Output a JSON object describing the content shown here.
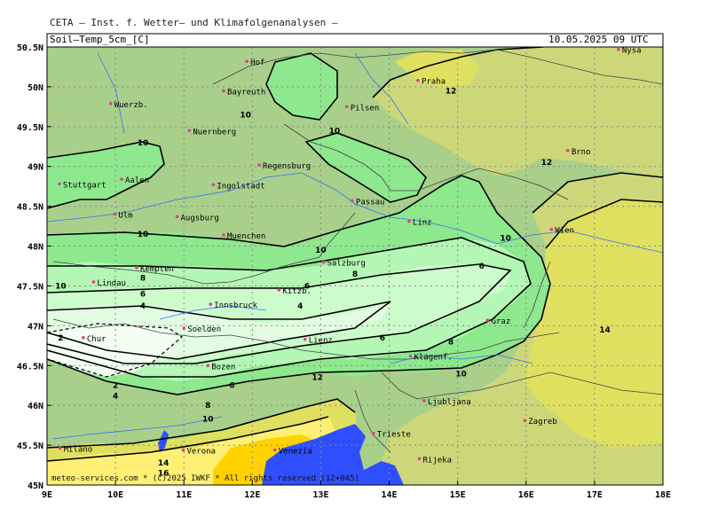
{
  "header": {
    "title": "CETA — Inst. f. Wetter— und Klimafolgenanalysen —",
    "field": "Soil—Temp_5cm",
    "unit": "C",
    "datetime": "10.05.2025 09 UTC"
  },
  "footer": "meteo-services.com * (c)2025 IWKF * All rights reserved (12+045)",
  "axes": {
    "y_labels": [
      "50.5N",
      "50N",
      "49.5N",
      "49N",
      "48.5N",
      "48N",
      "47.5N",
      "47N",
      "46.5N",
      "46N",
      "45.5N",
      "45N"
    ],
    "x_labels": [
      "9E",
      "10E",
      "11E",
      "12E",
      "13E",
      "14E",
      "15E",
      "16E",
      "17E",
      "18E"
    ]
  },
  "cities": [
    {
      "name": "Nysa",
      "lon": 17.35,
      "lat": 50.47
    },
    {
      "name": "Praha",
      "lon": 14.42,
      "lat": 50.08
    },
    {
      "name": "Hof",
      "lon": 11.92,
      "lat": 50.32
    },
    {
      "name": "Bayreuth",
      "lon": 11.58,
      "lat": 49.95
    },
    {
      "name": "Wuerzb.",
      "lon": 9.93,
      "lat": 49.79
    },
    {
      "name": "Pilsen",
      "lon": 13.38,
      "lat": 49.75
    },
    {
      "name": "Nuernberg",
      "lon": 11.08,
      "lat": 49.45
    },
    {
      "name": "Brno",
      "lon": 16.61,
      "lat": 49.2
    },
    {
      "name": "Regensburg",
      "lon": 12.1,
      "lat": 49.02
    },
    {
      "name": "Aalen",
      "lon": 10.09,
      "lat": 48.84
    },
    {
      "name": "Stuttgart",
      "lon": 9.18,
      "lat": 48.78
    },
    {
      "name": "Ingolstadt",
      "lon": 11.43,
      "lat": 48.77
    },
    {
      "name": "Passau",
      "lon": 13.46,
      "lat": 48.57
    },
    {
      "name": "Augsburg",
      "lon": 10.9,
      "lat": 48.37
    },
    {
      "name": "Ulm",
      "lon": 9.99,
      "lat": 48.4
    },
    {
      "name": "Linz",
      "lon": 14.29,
      "lat": 48.31
    },
    {
      "name": "Wien",
      "lon": 16.37,
      "lat": 48.21
    },
    {
      "name": "Muenchen",
      "lon": 11.58,
      "lat": 48.14
    },
    {
      "name": "Salzburg",
      "lon": 13.04,
      "lat": 47.8
    },
    {
      "name": "Kempten",
      "lon": 10.31,
      "lat": 47.73
    },
    {
      "name": "Lindau",
      "lon": 9.68,
      "lat": 47.55
    },
    {
      "name": "Kitzb.",
      "lon": 12.39,
      "lat": 47.45
    },
    {
      "name": "Innsbruck",
      "lon": 11.39,
      "lat": 47.27
    },
    {
      "name": "Graz",
      "lon": 15.44,
      "lat": 47.07
    },
    {
      "name": "Soelden",
      "lon": 11.0,
      "lat": 46.97
    },
    {
      "name": "Chur",
      "lon": 9.53,
      "lat": 46.85
    },
    {
      "name": "Lienz",
      "lon": 12.77,
      "lat": 46.83
    },
    {
      "name": "Klagenf.",
      "lon": 14.31,
      "lat": 46.62
    },
    {
      "name": "Bozen",
      "lon": 11.35,
      "lat": 46.5
    },
    {
      "name": "Ljubljana",
      "lon": 14.51,
      "lat": 46.06
    },
    {
      "name": "Zagreb",
      "lon": 15.98,
      "lat": 45.81
    },
    {
      "name": "Trieste",
      "lon": 13.77,
      "lat": 45.65
    },
    {
      "name": "Venezia",
      "lon": 12.33,
      "lat": 45.44
    },
    {
      "name": "Milano",
      "lon": 9.19,
      "lat": 45.46
    },
    {
      "name": "Verona",
      "lon": 10.99,
      "lat": 45.44
    },
    {
      "name": "Rijeka",
      "lon": 14.44,
      "lat": 45.33
    }
  ],
  "contour_labels": [
    {
      "text": "12",
      "lon": 14.9,
      "lat": 49.95
    },
    {
      "text": "10",
      "lon": 11.9,
      "lat": 49.65
    },
    {
      "text": "10",
      "lon": 13.2,
      "lat": 49.45
    },
    {
      "text": "10",
      "lon": 10.4,
      "lat": 49.3
    },
    {
      "text": "12",
      "lon": 16.3,
      "lat": 49.05
    },
    {
      "text": "10",
      "lon": 10.4,
      "lat": 48.15
    },
    {
      "text": "10",
      "lon": 15.7,
      "lat": 48.1
    },
    {
      "text": "10",
      "lon": 13.0,
      "lat": 47.95
    },
    {
      "text": "6",
      "lon": 15.35,
      "lat": 47.75
    },
    {
      "text": "8",
      "lon": 13.5,
      "lat": 47.65
    },
    {
      "text": "8",
      "lon": 10.4,
      "lat": 47.6
    },
    {
      "text": "10",
      "lon": 9.2,
      "lat": 47.5
    },
    {
      "text": "6",
      "lon": 12.8,
      "lat": 47.5
    },
    {
      "text": "6",
      "lon": 10.4,
      "lat": 47.4
    },
    {
      "text": "4",
      "lon": 10.4,
      "lat": 47.25
    },
    {
      "text": "4",
      "lon": 12.7,
      "lat": 47.25
    },
    {
      "text": "6",
      "lon": 13.9,
      "lat": 46.85
    },
    {
      "text": "8",
      "lon": 14.9,
      "lat": 46.8
    },
    {
      "text": "2",
      "lon": 9.2,
      "lat": 46.85
    },
    {
      "text": "10",
      "lon": 15.05,
      "lat": 46.4
    },
    {
      "text": "6",
      "lon": 11.7,
      "lat": 46.25
    },
    {
      "text": "2",
      "lon": 10.0,
      "lat": 46.25
    },
    {
      "text": "4",
      "lon": 10.0,
      "lat": 46.12
    },
    {
      "text": "12",
      "lon": 12.95,
      "lat": 46.35
    },
    {
      "text": "8",
      "lon": 11.35,
      "lat": 46.0
    },
    {
      "text": "10",
      "lon": 11.35,
      "lat": 45.83
    },
    {
      "text": "14",
      "lon": 17.15,
      "lat": 46.95
    },
    {
      "text": "14",
      "lon": 10.7,
      "lat": 45.28
    },
    {
      "text": "16",
      "lon": 10.7,
      "lat": 45.15
    }
  ],
  "colors": {
    "c8_10": "#8ee88e",
    "c10_12": "#a8d08a",
    "c12_14": "#ccd77a",
    "c14_16": "#e0e060",
    "c6_8": "#b4f7b4",
    "c4_6": "#ccfccc",
    "c2_4": "#e2fce2",
    "c0_2": "#f2fff2",
    "c16_18": "#fff075",
    "c18_20": "#ffd200",
    "sea": "#2f4fff"
  }
}
